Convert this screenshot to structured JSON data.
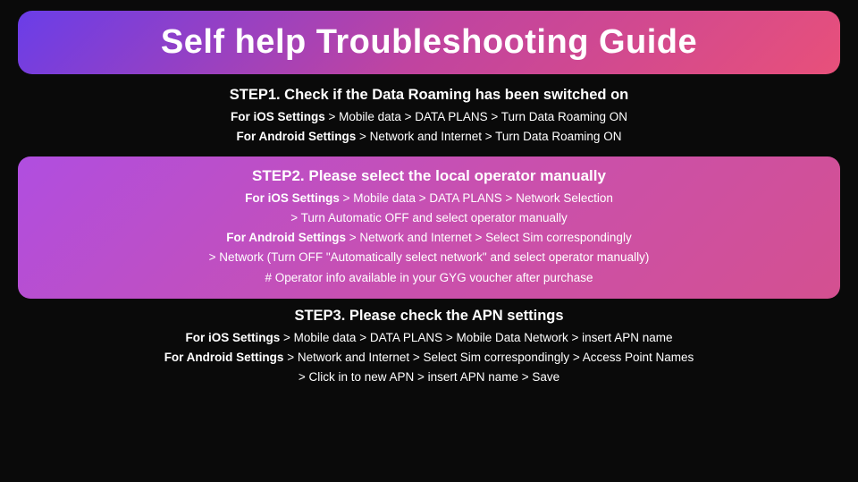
{
  "title": "Self help Troubleshooting Guide",
  "steps": [
    {
      "id": "step1",
      "heading": "STEP1. Check if the Data Roaming has been switched on",
      "lines": [
        {
          "bold": "For iOS Settings",
          "rest": " > Mobile data > DATA PLANS > Turn Data Roaming ON"
        },
        {
          "bold": "For Android Settings",
          "rest": " > Network and Internet > Turn Data Roaming ON"
        }
      ],
      "highlighted": false
    },
    {
      "id": "step2",
      "heading": "STEP2. Please select the local operator manually",
      "lines": [
        {
          "bold": "For iOS Settings",
          "rest": " > Mobile data > DATA PLANS > Network Selection"
        },
        {
          "bold": "",
          "rest": "> Turn Automatic OFF and select operator manually"
        },
        {
          "bold": "For Android Settings",
          "rest": " > Network and Internet > Select Sim correspondingly"
        },
        {
          "bold": "",
          "rest": "> Network (Turn OFF \"Automatically select network\" and select operator manually)"
        },
        {
          "bold": "",
          "rest": "# Operator info available in your GYG voucher after purchase"
        }
      ],
      "highlighted": true
    },
    {
      "id": "step3",
      "heading": "STEP3. Please check the APN settings",
      "lines": [
        {
          "bold": "For iOS Settings",
          "rest": " > Mobile data > DATA PLANS > Mobile Data Network > insert APN name"
        },
        {
          "bold": "For Android Settings",
          "rest": " > Network and Internet > Select Sim correspondingly > Access Point Names"
        },
        {
          "bold": "",
          "rest": "> Click in to new APN > insert APN name > Save"
        }
      ],
      "highlighted": false
    }
  ]
}
